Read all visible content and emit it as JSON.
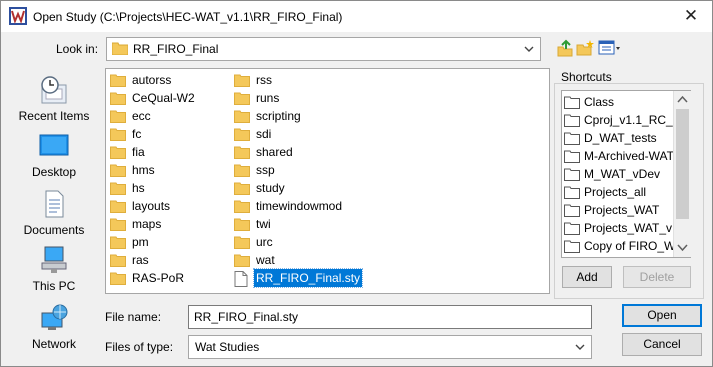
{
  "window": {
    "title": "Open Study  (C:\\Projects\\HEC-WAT_v1.1\\RR_FIRO_Final)",
    "close_glyph": "✕",
    "app_icon": "wat-app-icon"
  },
  "look_in": {
    "label": "Look in:",
    "value": "RR_FIRO_Final"
  },
  "toolbar": [
    {
      "name": "up-one-level-icon"
    },
    {
      "name": "new-folder-icon"
    },
    {
      "name": "view-menu-icon"
    }
  ],
  "sidebar": {
    "items": [
      {
        "label": "Recent Items",
        "icon": "recent-items-icon"
      },
      {
        "label": "Desktop",
        "icon": "desktop-icon"
      },
      {
        "label": "Documents",
        "icon": "documents-icon"
      },
      {
        "label": "This PC",
        "icon": "this-pc-icon"
      },
      {
        "label": "Network",
        "icon": "network-icon"
      }
    ]
  },
  "files": {
    "column1": [
      "autorss",
      "CeQual-W2",
      "ecc",
      "fc",
      "fia",
      "hms",
      "hs",
      "layouts",
      "maps",
      "pm",
      "ras",
      "RAS-PoR"
    ],
    "column2": [
      "rss",
      "runs",
      "scripting",
      "sdi",
      "shared",
      "ssp",
      "study",
      "timewindowmod",
      "twi",
      "urc",
      "wat",
      "RR_FIRO_Final.sty"
    ],
    "selected": "RR_FIRO_Final.sty"
  },
  "shortcuts": {
    "label": "Shortcuts",
    "items": [
      "Class",
      "Cproj_v1.1_RC_",
      "D_WAT_tests",
      "M-Archived-WAT",
      "M_WAT_vDev",
      "Projects_all",
      "Projects_WAT",
      "Projects_WAT_v",
      "Copy of FIRO_WAT"
    ],
    "add_label": "Add",
    "delete_label": "Delete"
  },
  "file_name": {
    "label": "File name:",
    "value": "RR_FIRO_Final.sty"
  },
  "file_type": {
    "label": "Files of type:",
    "value": "Wat Studies"
  },
  "buttons": {
    "open": "Open",
    "cancel": "Cancel"
  },
  "colors": {
    "selection": "#0078d7",
    "folder": "#f4c85a",
    "dialog_bg": "#f0f0f0"
  }
}
